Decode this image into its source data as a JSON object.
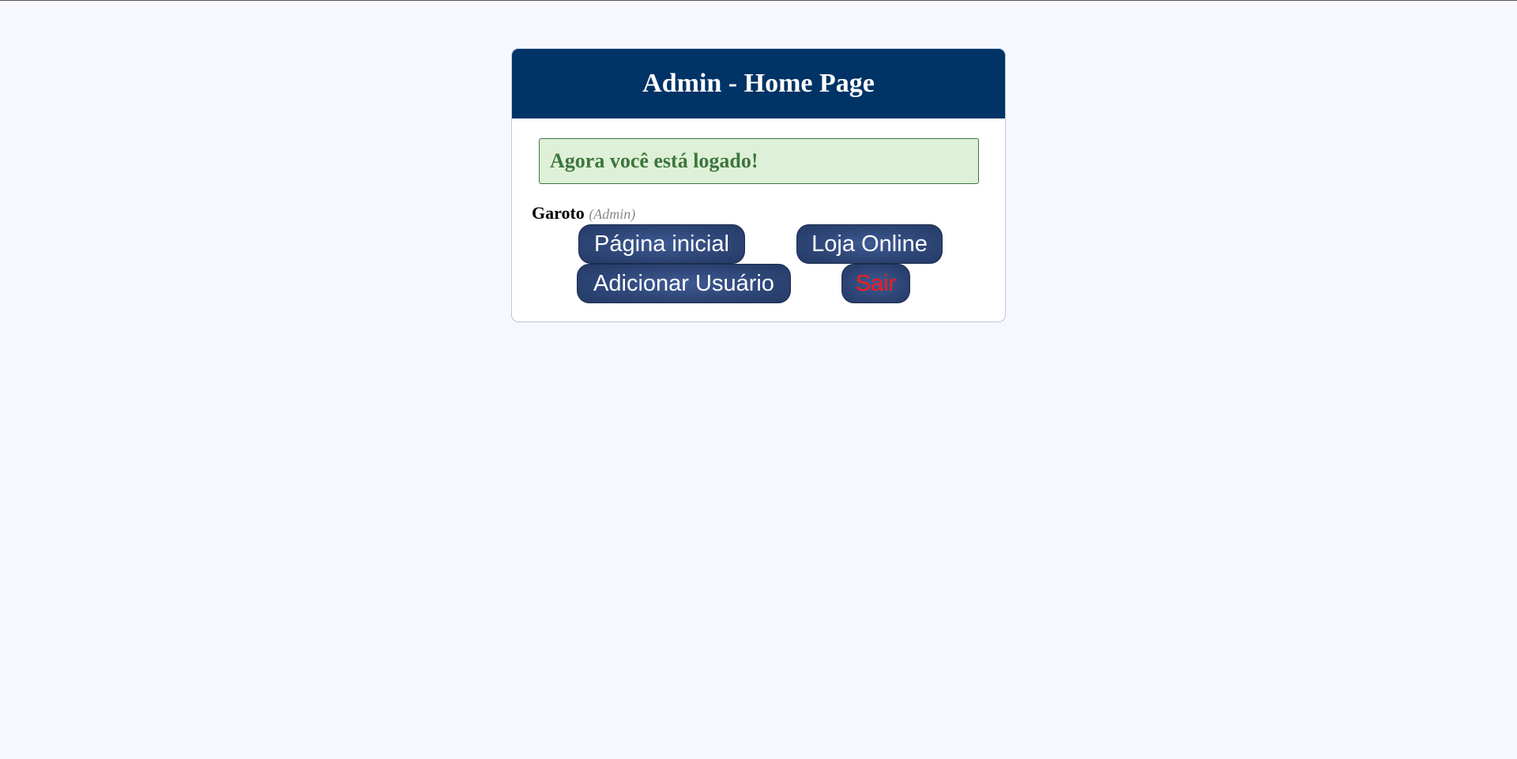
{
  "header": {
    "title": "Admin - Home Page"
  },
  "alert": {
    "message": "Agora você está logado!"
  },
  "user": {
    "name": "Garoto",
    "role": "(Admin)"
  },
  "actions": {
    "home_label": "Página inicial",
    "shop_label": "Loja Online",
    "add_user_label": "Adicionar Usuário",
    "logout_label": "Sair"
  },
  "colors": {
    "header_bg": "#003366",
    "alert_bg": "#dff0d8",
    "alert_text": "#3c763d",
    "button_bg": "#2d4575",
    "logout_text": "#ff1a1a",
    "page_bg": "#f6f8fe"
  }
}
